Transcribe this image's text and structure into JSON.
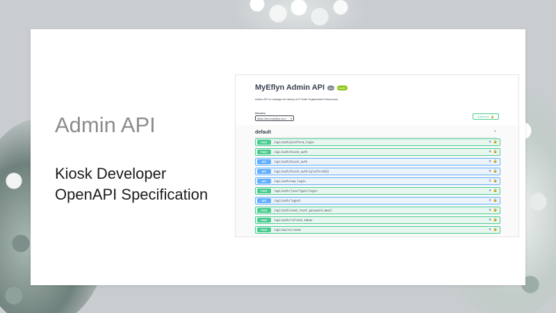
{
  "slide": {
    "title": "Admin API",
    "subtitle_line1": "Kiosk Developer",
    "subtitle_line2": "OpenAPI Specification"
  },
  "swagger": {
    "title": "MyEflyn Admin API",
    "version_badge": "1.0",
    "oas_badge": "OAS3",
    "description": "Admin API to manage all variety of E Suite Organization Resources",
    "servers_label": "Servers",
    "server_value": "https://dev.myeflyn.com",
    "authorize_label": "Authorize",
    "tag_name": "default",
    "operations": [
      {
        "method": "POST",
        "path": "/api/auth/platform_login"
      },
      {
        "method": "POST",
        "path": "/api/auth/kiosk_auth"
      },
      {
        "method": "GET",
        "path": "/api/auth/kiosk_auth"
      },
      {
        "method": "GET",
        "path": "/api/auth/kiosk_auth/{platformId}"
      },
      {
        "method": "GET",
        "path": "/api/auth/new_login"
      },
      {
        "method": "POST",
        "path": "/api/auth/{userType}/login"
      },
      {
        "method": "GET",
        "path": "/api/auth/logout"
      },
      {
        "method": "POST",
        "path": "/api/auth/send_reset_password_email"
      },
      {
        "method": "POST",
        "path": "/api/auth/refresh_token"
      },
      {
        "method": "POST",
        "path": "/api/mailer/send"
      }
    ]
  },
  "colors": {
    "post": "#49cc90",
    "get": "#61affe",
    "title_gray": "#8c8c8c"
  },
  "icons": {
    "expand": "chevron-down-icon",
    "lock": "lock-icon",
    "collapse": "chevron-up-icon"
  }
}
